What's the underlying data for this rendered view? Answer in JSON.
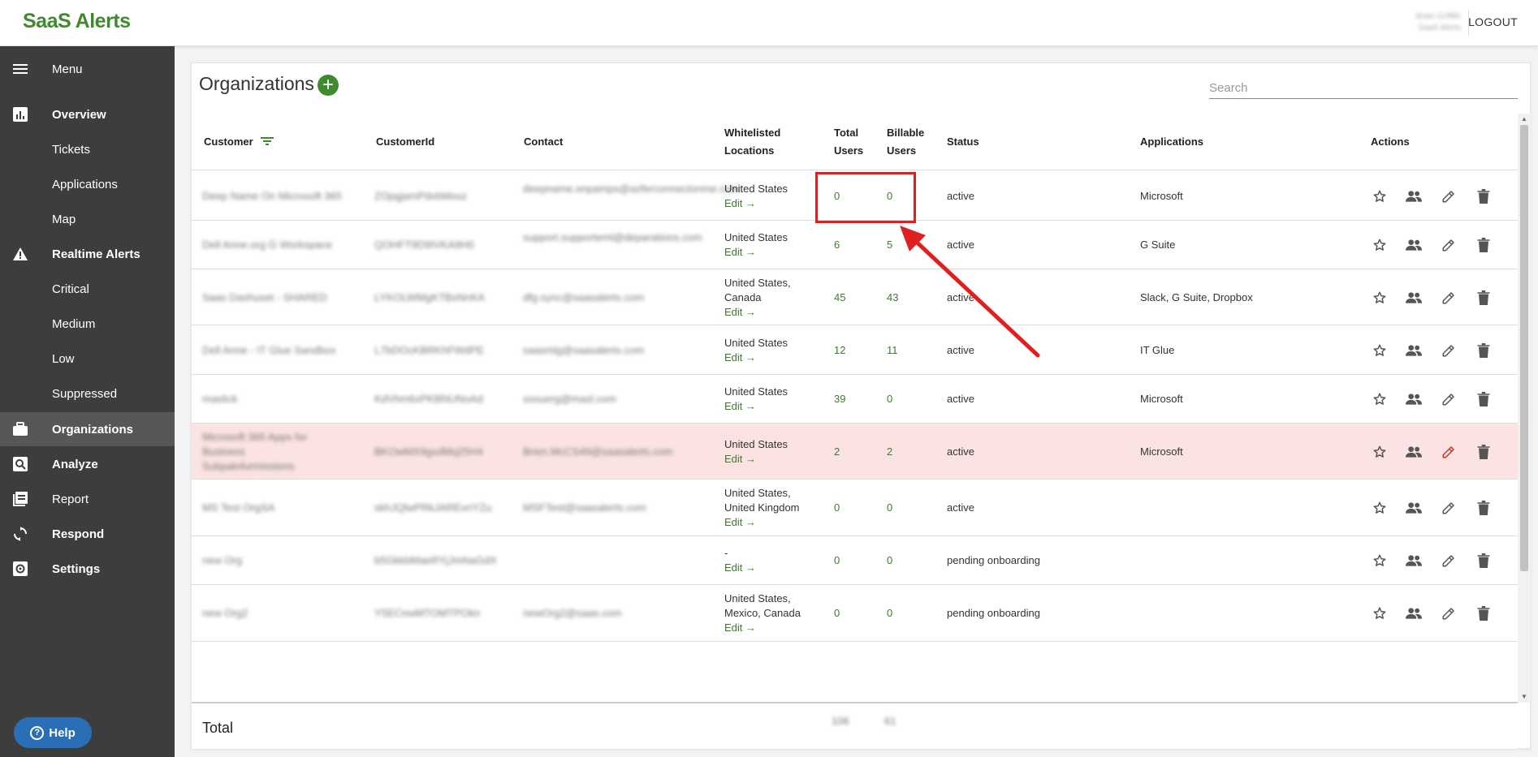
{
  "app": {
    "logo_text": "SaaS Alerts",
    "user_name": "Brian Griffith",
    "user_org": "SaaS Alerts",
    "logout_label": "LOGOUT"
  },
  "sidebar": {
    "items": [
      {
        "label": "Menu",
        "icon": "hamburger-icon",
        "bold": false
      },
      {
        "label": "Overview",
        "icon": "bar-chart-icon",
        "bold": true
      },
      {
        "label": "Tickets",
        "icon": "",
        "bold": false
      },
      {
        "label": "Applications",
        "icon": "",
        "bold": false
      },
      {
        "label": "Map",
        "icon": "",
        "bold": false
      },
      {
        "label": "Realtime Alerts",
        "icon": "warning-icon",
        "bold": true
      },
      {
        "label": "Critical",
        "icon": "",
        "bold": false
      },
      {
        "label": "Medium",
        "icon": "",
        "bold": false
      },
      {
        "label": "Low",
        "icon": "",
        "bold": false
      },
      {
        "label": "Suppressed",
        "icon": "",
        "bold": false
      },
      {
        "label": "Organizations",
        "icon": "briefcase-icon",
        "bold": true,
        "active": true
      },
      {
        "label": "Analyze",
        "icon": "magnify-icon",
        "bold": true
      },
      {
        "label": "Report",
        "icon": "report-icon",
        "bold": false
      },
      {
        "label": "Respond",
        "icon": "sync-icon",
        "bold": true
      },
      {
        "label": "Settings",
        "icon": "gear-icon",
        "bold": true
      }
    ],
    "help_label": "Help"
  },
  "page": {
    "title": "Organizations",
    "search_placeholder": "Search"
  },
  "table": {
    "headers": {
      "customer": "Customer",
      "customer_id": "CustomerId",
      "contact": "Contact",
      "whitelisted_1": "Whitelisted",
      "whitelisted_2": "Locations",
      "total_1": "Total",
      "total_2": "Users",
      "billable_1": "Billable",
      "billable_2": "Users",
      "status": "Status",
      "applications": "Applications",
      "actions": "Actions"
    },
    "edit_label": "Edit →",
    "rows": [
      {
        "customer": "Deep Name On Microsoft 365",
        "customer_id": "ZOpgjamPdvbMosz",
        "contact": "deepname.onpamps@azferconnectonme.com",
        "locations": [
          "United States"
        ],
        "total": "0",
        "billable": "0",
        "status": "active",
        "applications": "Microsoft"
      },
      {
        "customer": "Dell Anne.org G Workspace",
        "customer_id": "QOHFT9D9IVKA9H0",
        "contact": "support.supporteml@deparations.com",
        "locations": [
          "United States"
        ],
        "total": "6",
        "billable": "5",
        "status": "active",
        "applications": "G Suite"
      },
      {
        "customer": "Saas Dashuset - SHARED",
        "customer_id": "LYKOLWMgKTBsNnKA",
        "contact": "dfg.sync@saasalerts.com",
        "locations": [
          "United States,",
          "Canada"
        ],
        "total": "45",
        "billable": "43",
        "status": "active",
        "applications": "Slack, G Suite, Dropbox"
      },
      {
        "customer": "Dell Anne - IT Glue Sandbox",
        "customer_id": "L7bDOcKBRKhFWdPE",
        "contact": "saasmlg@saasalerts.com",
        "locations": [
          "United States"
        ],
        "total": "12",
        "billable": "11",
        "status": "active",
        "applications": "IT Glue"
      },
      {
        "customer": "maslick",
        "customer_id": "KdVhm6xPKBNUNoAd",
        "contact": "sosuerg@masl.com",
        "locations": [
          "United States"
        ],
        "total": "39",
        "billable": "0",
        "status": "active",
        "applications": "Microsoft"
      },
      {
        "customer": "Microsoft 365 Apps for Business Subpalofurmissions",
        "customer_id": "BKOwMX9gxdMq25H4",
        "contact": "Brien.McCS49@saasalerts.com",
        "locations": [
          "United States"
        ],
        "total": "2",
        "billable": "2",
        "status": "active",
        "applications": "Microsoft"
      },
      {
        "customer": "MS Test OrgSA",
        "customer_id": "skhJQlwPRkJAREvnYZu",
        "contact": "MSFTest@saasalerts.com",
        "locations": [
          "United States,",
          "United Kingdom"
        ],
        "total": "0",
        "billable": "0",
        "status": "active",
        "applications": ""
      },
      {
        "customer": "new Org",
        "customer_id": "b5GkkbMaeRYjJmNaGdX",
        "contact": "",
        "locations": [
          "-"
        ],
        "total": "0",
        "billable": "0",
        "status": "pending onboarding",
        "applications": ""
      },
      {
        "customer": "new Org2",
        "customer_id": "Y5ECnwMTOMTPOkn",
        "contact": "newOrg2@saas.com",
        "locations": [
          "United States,",
          "Mexico, Canada"
        ],
        "total": "0",
        "billable": "0",
        "status": "pending onboarding",
        "applications": ""
      }
    ],
    "total_label": "Total",
    "total_users": "106",
    "total_billable": "61"
  },
  "colors": {
    "brand_green": "#3f8a2e",
    "sidebar_bg": "#3d3d3d",
    "highlight_row": "#fbe3e3",
    "annotation_red": "#e02020"
  }
}
